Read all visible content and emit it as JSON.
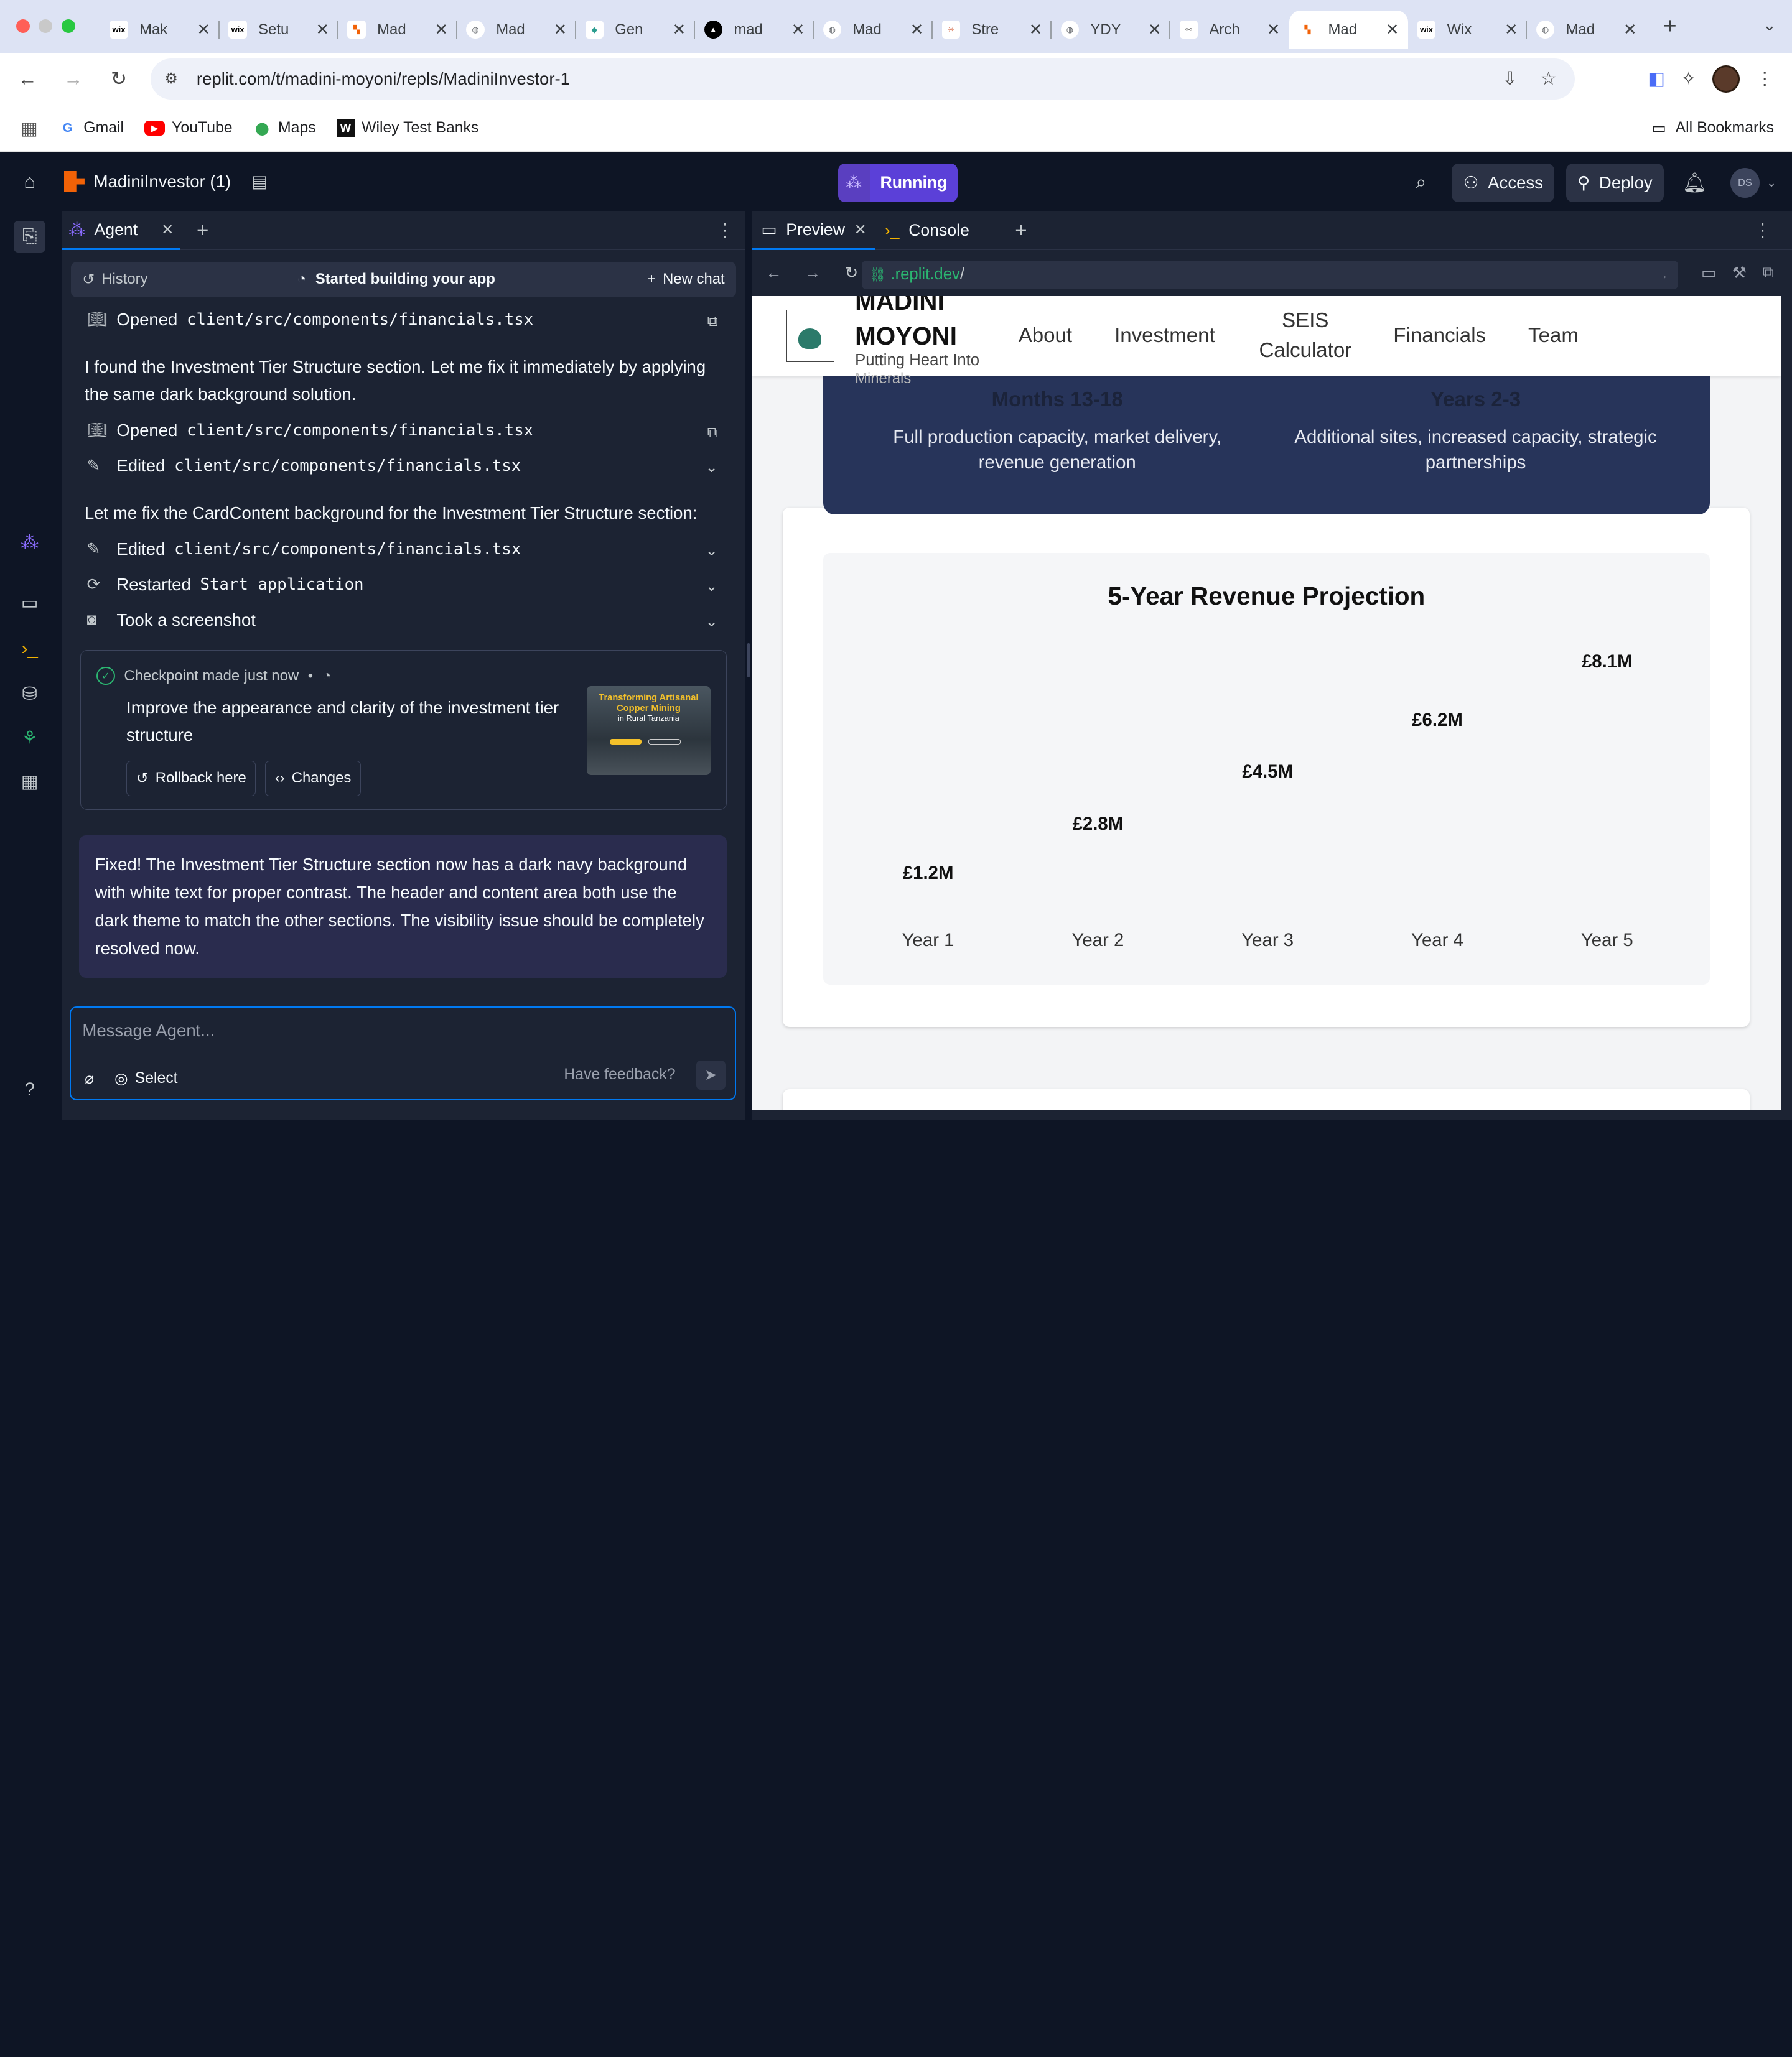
{
  "browser": {
    "tabs": [
      {
        "name": "Mak",
        "favicon": "wix"
      },
      {
        "name": "Setu",
        "favicon": "wix"
      },
      {
        "name": "Mad",
        "favicon": "replit"
      },
      {
        "name": "Mad",
        "favicon": "globe"
      },
      {
        "name": "Gen",
        "favicon": "diamond"
      },
      {
        "name": "mad",
        "favicon": "triangle"
      },
      {
        "name": "Mad",
        "favicon": "globe"
      },
      {
        "name": "Stre",
        "favicon": "sunburst"
      },
      {
        "name": "YDY",
        "favicon": "globe"
      },
      {
        "name": "Arch",
        "favicon": "archive"
      },
      {
        "name": "Mad",
        "favicon": "replit",
        "active": true
      },
      {
        "name": "Wix",
        "favicon": "wix"
      },
      {
        "name": "Mad",
        "favicon": "globe"
      }
    ],
    "url": "replit.com/t/madini-moyoni/repls/MadiniInvestor-1",
    "bookmarks": [
      "Gmail",
      "YouTube",
      "Maps",
      "Wiley Test Banks"
    ],
    "all_bookmarks": "All Bookmarks"
  },
  "replit": {
    "project_name": "MadiniInvestor (1)",
    "run_status": "Running",
    "access_label": "Access",
    "deploy_label": "Deploy",
    "user_initials": "DS"
  },
  "agent": {
    "tab_label": "Agent",
    "history_label": "History",
    "status_label": "Started building your app",
    "new_chat_label": "New chat",
    "actions": [
      {
        "verb": "Opened",
        "target": "client/src/components/financials.tsx"
      },
      {
        "verb": "Opened",
        "target": "client/src/components/financials.tsx"
      },
      {
        "verb": "Edited",
        "target": "client/src/components/financials.tsx"
      },
      {
        "verb": "Edited",
        "target": "client/src/components/financials.tsx"
      },
      {
        "verb": "Restarted",
        "target": "Start application"
      },
      {
        "verb": "Took a screenshot",
        "target": ""
      }
    ],
    "message_1": "I found the Investment Tier Structure section. Let me fix it immediately by applying the same dark background solution.",
    "message_2": "Let me fix the CardContent background for the Investment Tier Structure section:",
    "checkpoint": {
      "label": "Checkpoint made",
      "time": "just now",
      "description": "Improve the appearance and clarity of the investment tier structure",
      "rollback_label": "Rollback here",
      "changes_label": "Changes",
      "thumb_title": "Transforming Artisanal Copper Mining",
      "thumb_sub": "in Rural Tanzania"
    },
    "final_message": "Fixed! The Investment Tier Structure section now has a dark navy background with white text for proper contrast. The header and content area both use the dark theme to match the other sections. The visibility issue should be completely resolved now.",
    "input_placeholder": "Message Agent...",
    "select_label": "Select",
    "feedback_label": "Have feedback?"
  },
  "preview": {
    "tab_preview": "Preview",
    "tab_console": "Console",
    "url_domain": ".replit.dev",
    "url_path": "/",
    "site": {
      "brand_line1": "MADINI",
      "brand_line2": "MOYONI",
      "tagline": "Putting Heart Into",
      "tagline_2": "Minerals",
      "nav": [
        "About",
        "Investment",
        "SEIS Calculator",
        "Financials",
        "Team"
      ],
      "phases": [
        {
          "title": "Months 13-18",
          "desc": "Full production capacity, market delivery, revenue generation"
        },
        {
          "title": "Years 2-3",
          "desc": "Additional sites, increased capacity, strategic partnerships"
        }
      ]
    }
  },
  "chart_data": {
    "type": "bar",
    "title": "5-Year Revenue Projection",
    "categories": [
      "Year 1",
      "Year 2",
      "Year 3",
      "Year 4",
      "Year 5"
    ],
    "values": [
      1.2,
      2.8,
      4.5,
      6.2,
      8.1
    ],
    "value_labels": [
      "£1.2M",
      "£2.8M",
      "£4.5M",
      "£6.2M",
      "£8.1M"
    ],
    "unit": "£M",
    "bars_visible": false
  }
}
